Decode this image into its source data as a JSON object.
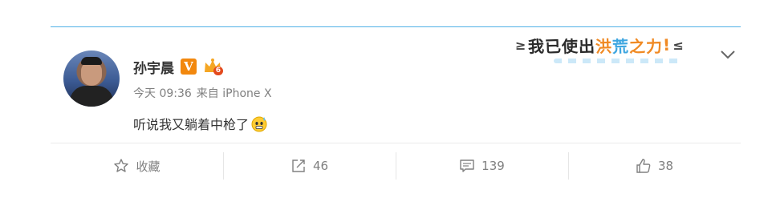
{
  "banner": {
    "deco_left": "≥",
    "chars": [
      "我",
      "已",
      "使",
      "出",
      "洪",
      "荒",
      "之",
      "力",
      "!"
    ],
    "deco_right": "≤"
  },
  "user": {
    "name": "孙宇晨",
    "verified_badge": "V",
    "vip_level": "6"
  },
  "meta": {
    "time": "今天 09:36",
    "source": "来自 iPhone X"
  },
  "post": {
    "text": "听说我又躺着中枪了",
    "emoji": "sweat-emoji"
  },
  "actions": {
    "favorite_label": "收藏",
    "repost_count": "46",
    "comment_count": "139",
    "like_count": "38"
  },
  "colors": {
    "accent_orange": "#f2880e",
    "banner_blue": "#3ea6e0",
    "meta_gray": "#808080",
    "rule_blue": "#4fb0e6"
  }
}
